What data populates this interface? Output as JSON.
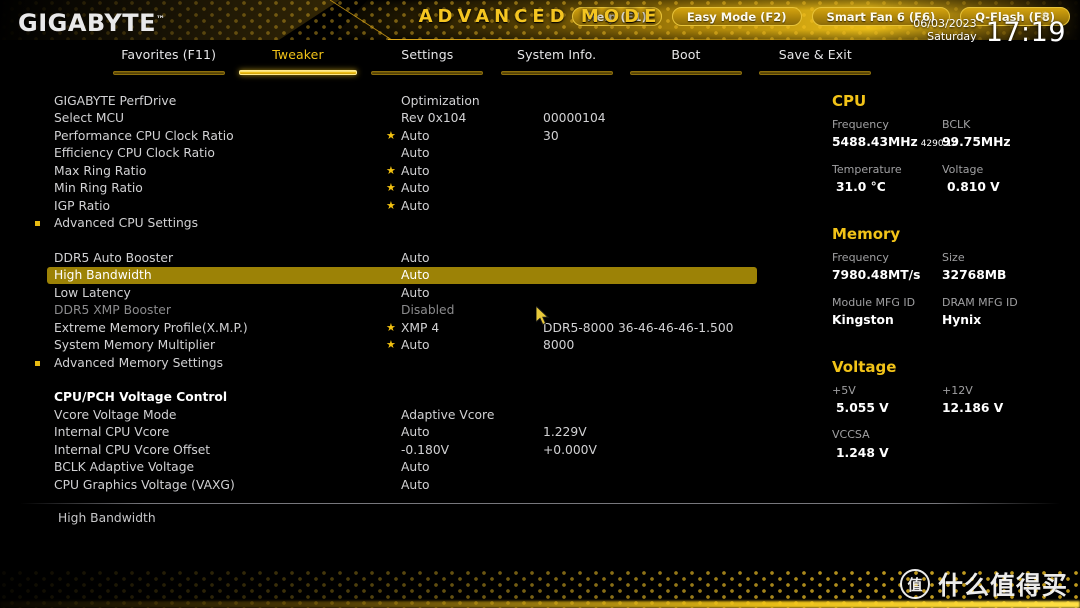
{
  "header": {
    "brand": "GIGABYTE",
    "brand_tm": "™",
    "mode_title": "ADVANCED MODE",
    "date": "06/03/2023",
    "weekday": "Saturday",
    "time": "17:19",
    "gear_icon": "gear-icon"
  },
  "tabs": [
    {
      "label": "Favorites (F11)",
      "active": false
    },
    {
      "label": "Tweaker",
      "active": true
    },
    {
      "label": "Settings",
      "active": false
    },
    {
      "label": "System Info.",
      "active": false
    },
    {
      "label": "Boot",
      "active": false
    },
    {
      "label": "Save & Exit",
      "active": false
    }
  ],
  "settings": [
    {
      "name": "GIGABYTE PerfDrive",
      "value": "Optimization",
      "value2": "",
      "star": false,
      "submenu": false,
      "state": "normal"
    },
    {
      "name": "Select MCU",
      "value": "Rev 0x104",
      "value2": "00000104",
      "star": false,
      "submenu": false,
      "state": "normal"
    },
    {
      "name": "Performance CPU Clock Ratio",
      "value": "Auto",
      "value2": "30",
      "star": true,
      "submenu": false,
      "state": "normal"
    },
    {
      "name": "Efficiency CPU Clock Ratio",
      "value": "Auto",
      "value2": "",
      "star": false,
      "submenu": false,
      "state": "normal"
    },
    {
      "name": "Max Ring Ratio",
      "value": "Auto",
      "value2": "",
      "star": true,
      "submenu": false,
      "state": "normal"
    },
    {
      "name": "Min Ring Ratio",
      "value": "Auto",
      "value2": "",
      "star": true,
      "submenu": false,
      "state": "normal"
    },
    {
      "name": "IGP Ratio",
      "value": "Auto",
      "value2": "",
      "star": true,
      "submenu": false,
      "state": "normal"
    },
    {
      "name": "Advanced CPU Settings",
      "value": "",
      "value2": "",
      "star": false,
      "submenu": true,
      "state": "normal"
    },
    {
      "name": "",
      "value": "",
      "value2": "",
      "star": false,
      "submenu": false,
      "state": "spacer"
    },
    {
      "name": "DDR5 Auto Booster",
      "value": "Auto",
      "value2": "",
      "star": false,
      "submenu": false,
      "state": "normal"
    },
    {
      "name": "High Bandwidth",
      "value": "Auto",
      "value2": "",
      "star": false,
      "submenu": false,
      "state": "highlight"
    },
    {
      "name": "Low Latency",
      "value": "Auto",
      "value2": "",
      "star": false,
      "submenu": false,
      "state": "normal"
    },
    {
      "name": "DDR5 XMP Booster",
      "value": "Disabled",
      "value2": "",
      "star": false,
      "submenu": false,
      "state": "dim"
    },
    {
      "name": "Extreme Memory Profile(X.M.P.)",
      "value": "XMP 4",
      "value2": "DDR5-8000 36-46-46-46-1.500",
      "star": true,
      "submenu": false,
      "state": "normal"
    },
    {
      "name": "System Memory Multiplier",
      "value": "Auto",
      "value2": "8000",
      "star": true,
      "submenu": false,
      "state": "normal"
    },
    {
      "name": "Advanced Memory Settings",
      "value": "",
      "value2": "",
      "star": false,
      "submenu": true,
      "state": "normal"
    },
    {
      "name": "",
      "value": "",
      "value2": "",
      "star": false,
      "submenu": false,
      "state": "spacer"
    },
    {
      "name": "CPU/PCH Voltage Control",
      "value": "",
      "value2": "",
      "star": false,
      "submenu": false,
      "state": "heading"
    },
    {
      "name": "Vcore Voltage Mode",
      "value": "Adaptive Vcore",
      "value2": "",
      "star": false,
      "submenu": false,
      "state": "normal"
    },
    {
      "name": "Internal CPU Vcore",
      "value": "Auto",
      "value2": "1.229V",
      "star": false,
      "submenu": false,
      "state": "normal"
    },
    {
      "name": "Internal CPU Vcore Offset",
      "value": "-0.180V",
      "value2": "+0.000V",
      "star": false,
      "submenu": false,
      "state": "normal"
    },
    {
      "name": "BCLK Adaptive Voltage",
      "value": "Auto",
      "value2": "",
      "star": false,
      "submenu": false,
      "state": "normal"
    },
    {
      "name": "CPU Graphics Voltage (VAXG)",
      "value": "Auto",
      "value2": "",
      "star": false,
      "submenu": false,
      "state": "normal"
    }
  ],
  "panel": {
    "cpu": {
      "title": "CPU",
      "freq_label": "Frequency",
      "freq_value": "5488.43MHz",
      "freq_sub": "4290.14",
      "bclk_label": "BCLK",
      "bclk_value": "99.75MHz",
      "temp_label": "Temperature",
      "temp_value": "31.0 °C",
      "volt_label": "Voltage",
      "volt_value": "0.810 V"
    },
    "memory": {
      "title": "Memory",
      "freq_label": "Frequency",
      "freq_value": "7980.48MT/s",
      "size_label": "Size",
      "size_value": "32768MB",
      "module_label": "Module MFG ID",
      "module_value": "Kingston",
      "dram_label": "DRAM MFG ID",
      "dram_value": "Hynix"
    },
    "voltage": {
      "title": "Voltage",
      "p5v_label": "+5V",
      "p5v_value": "5.055 V",
      "p12v_label": "+12V",
      "p12v_value": "12.186 V",
      "vccsa_label": "VCCSA",
      "vccsa_value": "1.248 V"
    }
  },
  "help": {
    "text": "High Bandwidth"
  },
  "footer_buttons": [
    {
      "label": "Help (F1)"
    },
    {
      "label": "Easy Mode (F2)"
    },
    {
      "label": "Smart Fan 6 (F6)"
    },
    {
      "label": "Q-Flash (F8)"
    }
  ],
  "watermark": {
    "logo": "值",
    "text": "什么值得买"
  },
  "colors": {
    "accent": "#f2c318",
    "highlight_row": "#9c8206",
    "text": "#d2d2d4",
    "background": "#000000"
  }
}
